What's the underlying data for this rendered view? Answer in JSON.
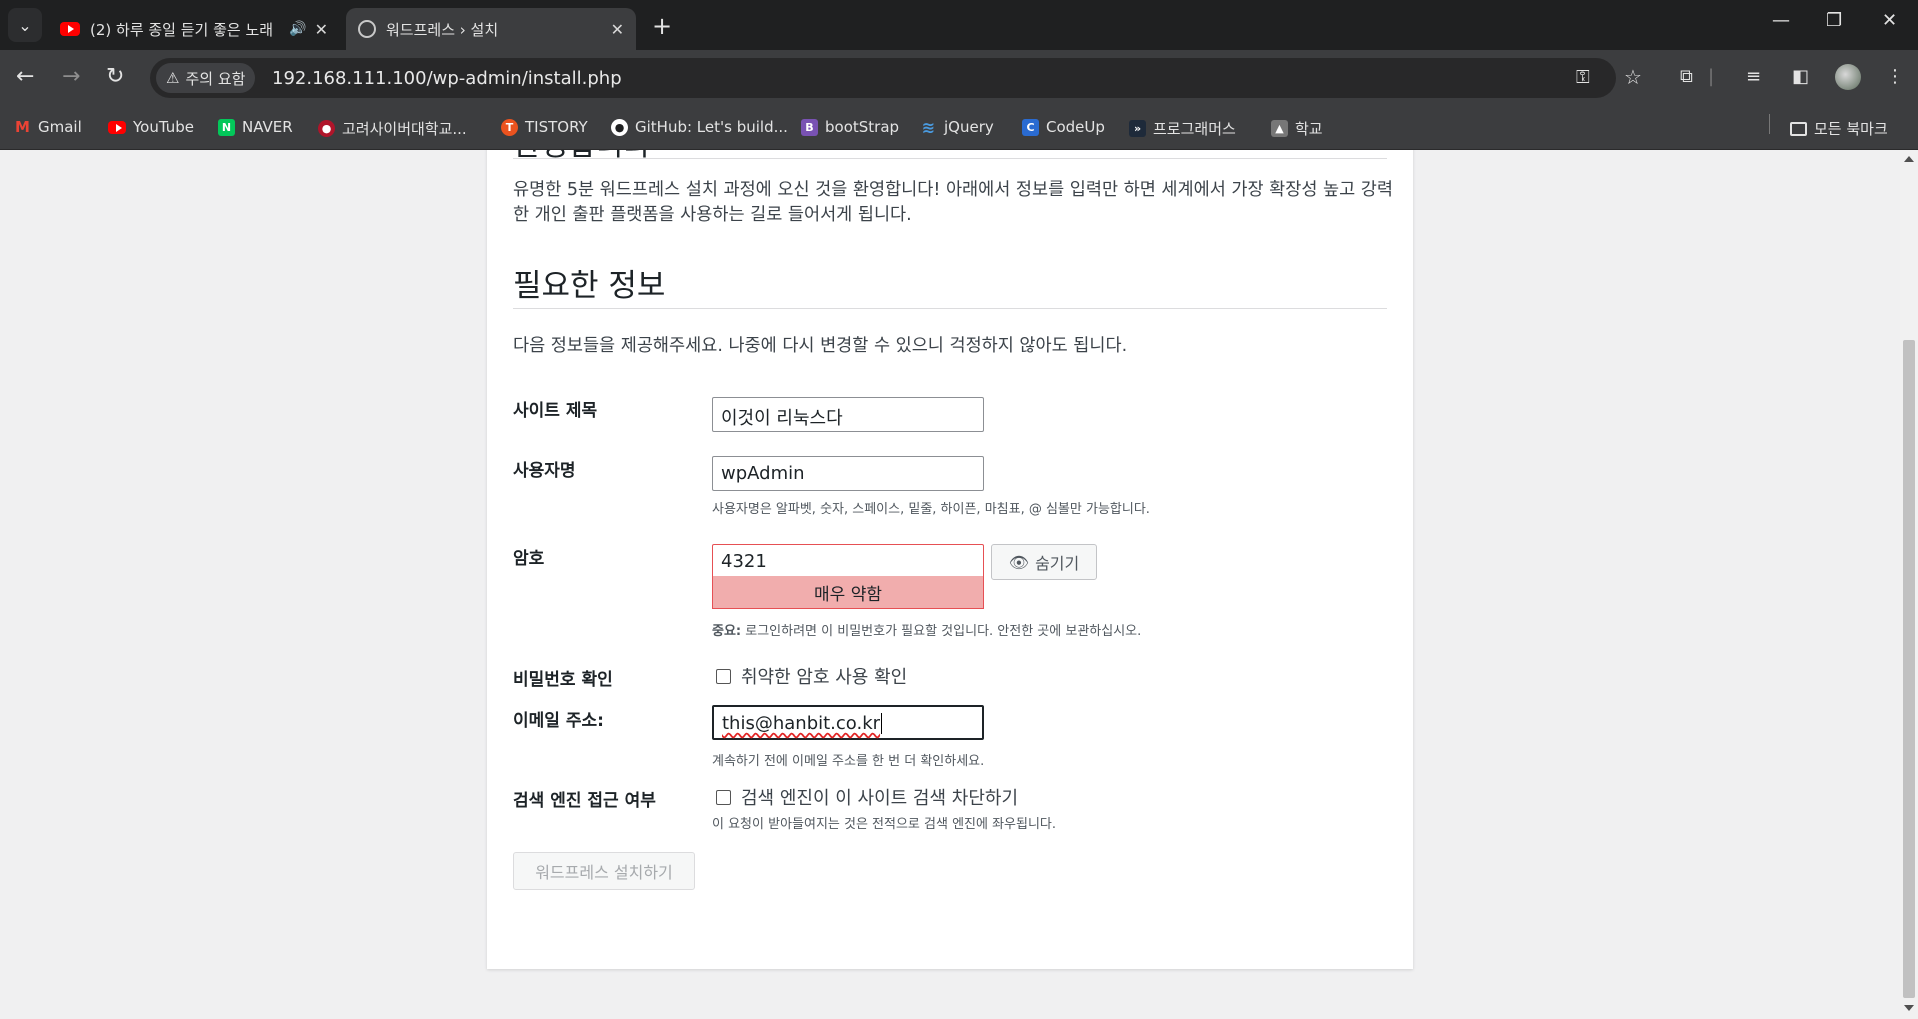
{
  "browser": {
    "tabs": [
      {
        "title": "(2) 하루 종일 듣기 좋은 노래",
        "favicon": "youtube-icon",
        "audio": true
      },
      {
        "title": "워드프레스 › 설치",
        "favicon": "globe-icon",
        "active": true
      }
    ],
    "security_chip": "주의 요함",
    "url": "192.168.111.100/wp-admin/install.php",
    "bookmarks": [
      {
        "label": "Gmail",
        "icon": "gmail-icon",
        "color": "#ea4335"
      },
      {
        "label": "YouTube",
        "icon": "youtube-icon",
        "color": "#ff0000"
      },
      {
        "label": "NAVER",
        "icon": "naver-icon",
        "color": "#03c75a"
      },
      {
        "label": "고려사이버대학교...",
        "icon": "university-icon",
        "color": "#b0152a"
      },
      {
        "label": "TISTORY",
        "icon": "tistory-icon",
        "color": "#eb531f"
      },
      {
        "label": "GitHub: Let's build...",
        "icon": "github-icon",
        "color": "#ffffff"
      },
      {
        "label": "bootStrap",
        "icon": "bootstrap-icon",
        "color": "#7952b3"
      },
      {
        "label": "jQuery",
        "icon": "jquery-icon",
        "color": "#0769ad"
      },
      {
        "label": "CodeUp",
        "icon": "codeup-icon",
        "color": "#2a6bd1"
      },
      {
        "label": "프로그래머스",
        "icon": "programmers-icon",
        "color": "#1e2a3a"
      },
      {
        "label": "학교",
        "icon": "school-icon",
        "color": "#777777"
      }
    ],
    "all_bookmarks": "모든 북마크"
  },
  "page": {
    "welcome_heading": "환영합니다",
    "welcome_text": "유명한 5분 워드프레스 설치 과정에 오신 것을 환영합니다! 아래에서 정보를 입력만 하면 세계에서 가장 확장성 높고 강력한 개인 출판 플랫폼을 사용하는 길로 들어서게 됩니다.",
    "info_heading": "필요한 정보",
    "info_text": "다음 정보들을 제공해주세요. 나중에 다시 변경할 수 있으니 걱정하지 않아도 됩니다.",
    "site_title_label": "사이트 제목",
    "site_title_value": "이것이 리눅스다",
    "username_label": "사용자명",
    "username_value": "wpAdmin",
    "username_hint": "사용자명은 알파벳, 숫자, 스페이스, 밑줄, 하이픈, 마침표, @ 심볼만 가능합니다.",
    "password_label": "암호",
    "password_value": "4321",
    "hide_button": "숨기기",
    "strength": "매우 약함",
    "password_hint_bold": "중요:",
    "password_hint": " 로그인하려면 이 비밀번호가 필요할 것입니다. 안전한 곳에 보관하십시오.",
    "confirm_label": "비밀번호 확인",
    "confirm_weak": "취약한 암호 사용 확인",
    "email_label": "이메일 주소:",
    "email_value": "this@hanbit.co.kr",
    "email_hint": "계속하기 전에 이메일 주소를 한 번 더 확인하세요.",
    "search_label": "검색 엔진 접근 여부",
    "search_checkbox": "검색 엔진이 이 사이트 검색 차단하기",
    "search_hint": "이 요청이 받아들여지는 것은 전적으로 검색 엔진에 좌우됩니다.",
    "submit_button": "워드프레스 설치하기"
  }
}
